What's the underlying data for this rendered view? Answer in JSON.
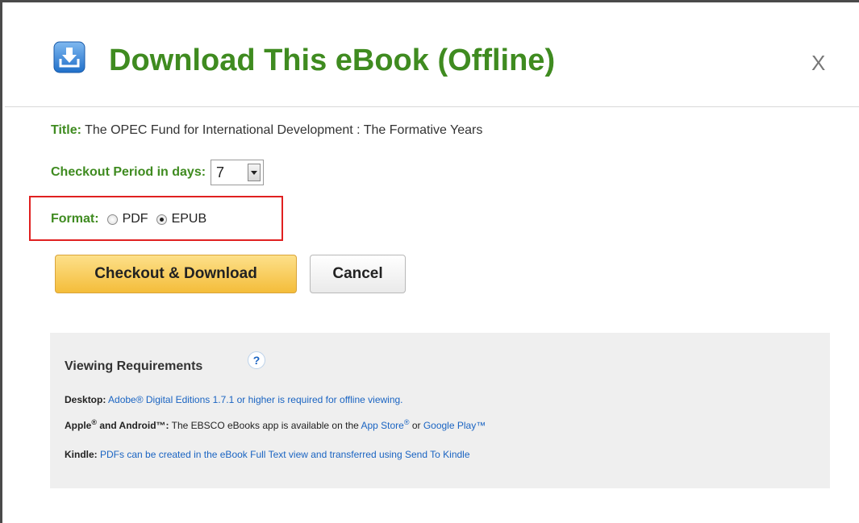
{
  "dialog": {
    "title": "Download This eBook (Offline)",
    "close_label": "X"
  },
  "book": {
    "title_label": "Title:",
    "title_value": "The OPEC Fund for International Development : The Formative Years"
  },
  "checkout_period": {
    "label": "Checkout Period in days:",
    "selected_value": "7"
  },
  "format": {
    "label": "Format:",
    "options": [
      {
        "label": "PDF",
        "selected": false
      },
      {
        "label": "EPUB",
        "selected": true
      }
    ]
  },
  "buttons": {
    "checkout": "Checkout & Download",
    "cancel": "Cancel"
  },
  "requirements": {
    "title": "Viewing Requirements",
    "help_icon": "?",
    "desktop": {
      "label": "Desktop:",
      "text": "Adobe® Digital Editions 1.7.1 or higher is required for offline viewing."
    },
    "mobile": {
      "label_a": "Apple",
      "label_b": " and Android™:",
      "text": " The EBSCO eBooks app is available on the ",
      "app_store": "App Store",
      "or": " or ",
      "google_play": "Google Play™"
    },
    "kindle": {
      "label": "Kindle:",
      "text": "PDFs can be created in the eBook Full Text view and transferred using Send To Kindle"
    }
  },
  "colors": {
    "accent_green": "#3f8b20",
    "link_blue": "#1a64c2",
    "highlight_red": "#e02020",
    "button_gold": "#f4bd3a"
  }
}
